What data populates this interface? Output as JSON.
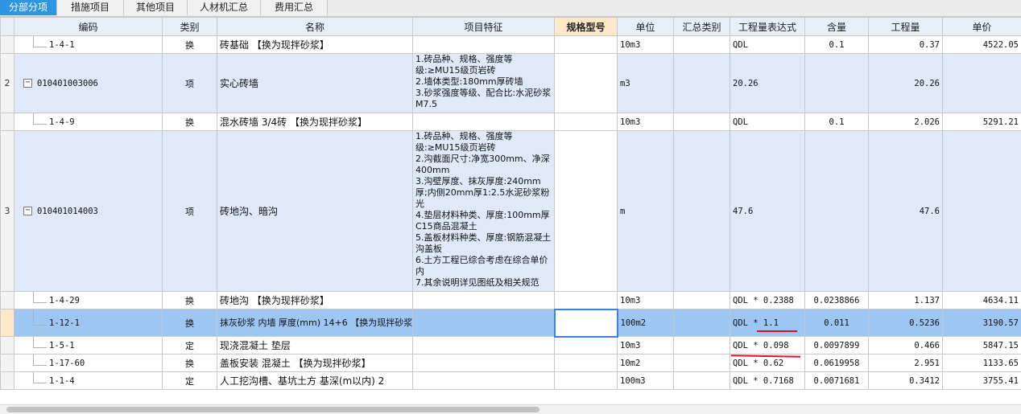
{
  "tabs": [
    {
      "label": "分部分项",
      "active": true
    },
    {
      "label": "措施项目",
      "active": false
    },
    {
      "label": "其他项目",
      "active": false
    },
    {
      "label": "人材机汇总",
      "active": false
    },
    {
      "label": "费用汇总",
      "active": false
    }
  ],
  "columns": [
    "",
    "编码",
    "类别",
    "名称",
    "项目特征",
    "规格型号",
    "单位",
    "汇总类别",
    "工程量表达式",
    "含量",
    "工程量",
    "单价"
  ],
  "rows": [
    {
      "num": "",
      "code": "1-4-1",
      "type": "换",
      "name": "砖基础  【换为现拌砂浆】",
      "feature": "",
      "spec": "",
      "unit": "10m3",
      "summary": "",
      "expr": "QDL",
      "content": "0.1",
      "qty": "0.37",
      "price": "4522.05"
    },
    {
      "num": "2",
      "code": "010401003006",
      "type": "项",
      "name": "实心砖墙",
      "feature": "1.砖品种、规格、强度等级:≥MU15级页岩砖\n2.墙体类型:180mm厚砖墙\n3.砂浆强度等级、配合比:水泥砂浆M7.5",
      "spec": "",
      "unit": "m3",
      "summary": "",
      "expr": "20.26",
      "content": "",
      "qty": "20.26",
      "price": ""
    },
    {
      "num": "",
      "code": "1-4-9",
      "type": "换",
      "name": "混水砖墙 3/4砖  【换为现拌砂浆】",
      "feature": "",
      "spec": "",
      "unit": "10m3",
      "summary": "",
      "expr": "QDL",
      "content": "0.1",
      "qty": "2.026",
      "price": "5291.21"
    },
    {
      "num": "3",
      "code": "010401014003",
      "type": "项",
      "name": "砖地沟、暗沟",
      "feature": "1.砖品种、规格、强度等级:≥MU15级页岩砖\n2.沟截面尺寸:净宽300mm、净深400mm\n3.沟壁厚度、抹灰厚度:240mm厚;内侧20mm厚1:2.5水泥砂浆粉光\n4.垫层材料种类、厚度:100mm厚C15商品混凝土\n5.盖板材料种类、厚度:钢筋混凝土沟盖板\n6.土方工程已综合考虑在综合单价内\n7.其余说明详见图纸及相关规范",
      "spec": "",
      "unit": "m",
      "summary": "",
      "expr": "47.6",
      "content": "",
      "qty": "47.6",
      "price": ""
    },
    {
      "num": "",
      "code": "1-4-29",
      "type": "换",
      "name": "砖地沟  【换为现拌砂浆】",
      "feature": "",
      "spec": "",
      "unit": "10m3",
      "summary": "",
      "expr": "QDL * 0.2388",
      "content": "0.0238866",
      "qty": "1.137",
      "price": "4634.11"
    },
    {
      "num": "",
      "code": "1-12-1",
      "type": "换",
      "name": "抹灰砂浆 内墙 厚度(mm) 14+6  【换为现拌砂浆】",
      "feature": "",
      "spec": "",
      "unit": "100m2",
      "summary": "",
      "expr": "QDL * 1.1",
      "content": "0.011",
      "qty": "0.5236",
      "price": "3190.57"
    },
    {
      "num": "",
      "code": "1-5-1",
      "type": "定",
      "name": "现浇混凝土 垫层",
      "feature": "",
      "spec": "",
      "unit": "10m3",
      "summary": "",
      "expr": "QDL * 0.098",
      "content": "0.0097899",
      "qty": "0.466",
      "price": "5847.15"
    },
    {
      "num": "",
      "code": "1-17-60",
      "type": "换",
      "name": "盖板安装 混凝土  【换为现拌砂浆】",
      "feature": "",
      "spec": "",
      "unit": "10m2",
      "summary": "",
      "expr": "QDL * 0.62",
      "content": "0.0619958",
      "qty": "2.951",
      "price": "1133.65"
    },
    {
      "num": "",
      "code": "1-1-4",
      "type": "定",
      "name": "人工挖沟槽、基坑土方 基深(m以内) 2",
      "feature": "",
      "spec": "",
      "unit": "100m3",
      "summary": "",
      "expr": "QDL * 0.7168",
      "content": "0.0071681",
      "qty": "0.3412",
      "price": "3755.41"
    }
  ],
  "colors": {
    "tab_active": "#2e95e0",
    "main_row": "#dfe9fa",
    "selected_row": "#9dc6f2",
    "annotation": "#d9142b"
  }
}
